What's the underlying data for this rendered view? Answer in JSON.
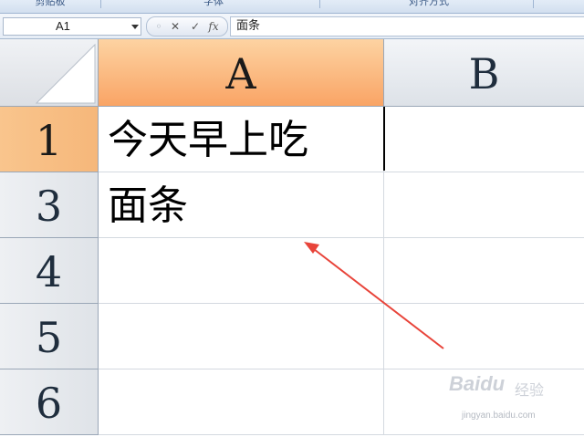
{
  "ribbon": {
    "groups": [
      "剪贴板",
      "字体",
      "对齐方式"
    ]
  },
  "formula_bar": {
    "name_box": "A1",
    "cancel_glyph": "✕",
    "enter_glyph": "✓",
    "function_glyph": "fx",
    "content": "面条"
  },
  "grid": {
    "columns": [
      "A",
      "B"
    ],
    "selected_column": "A",
    "rows": [
      "1",
      "3",
      "4",
      "5",
      "6"
    ],
    "selected_row": "1",
    "cells": {
      "A1": "今天早上吃",
      "A3": "面条"
    }
  },
  "annotation": {
    "type": "arrow",
    "color": "#e8443a"
  },
  "watermark": {
    "logo": "Baidu",
    "name": "经验",
    "url": "jingyan.baidu.com"
  }
}
